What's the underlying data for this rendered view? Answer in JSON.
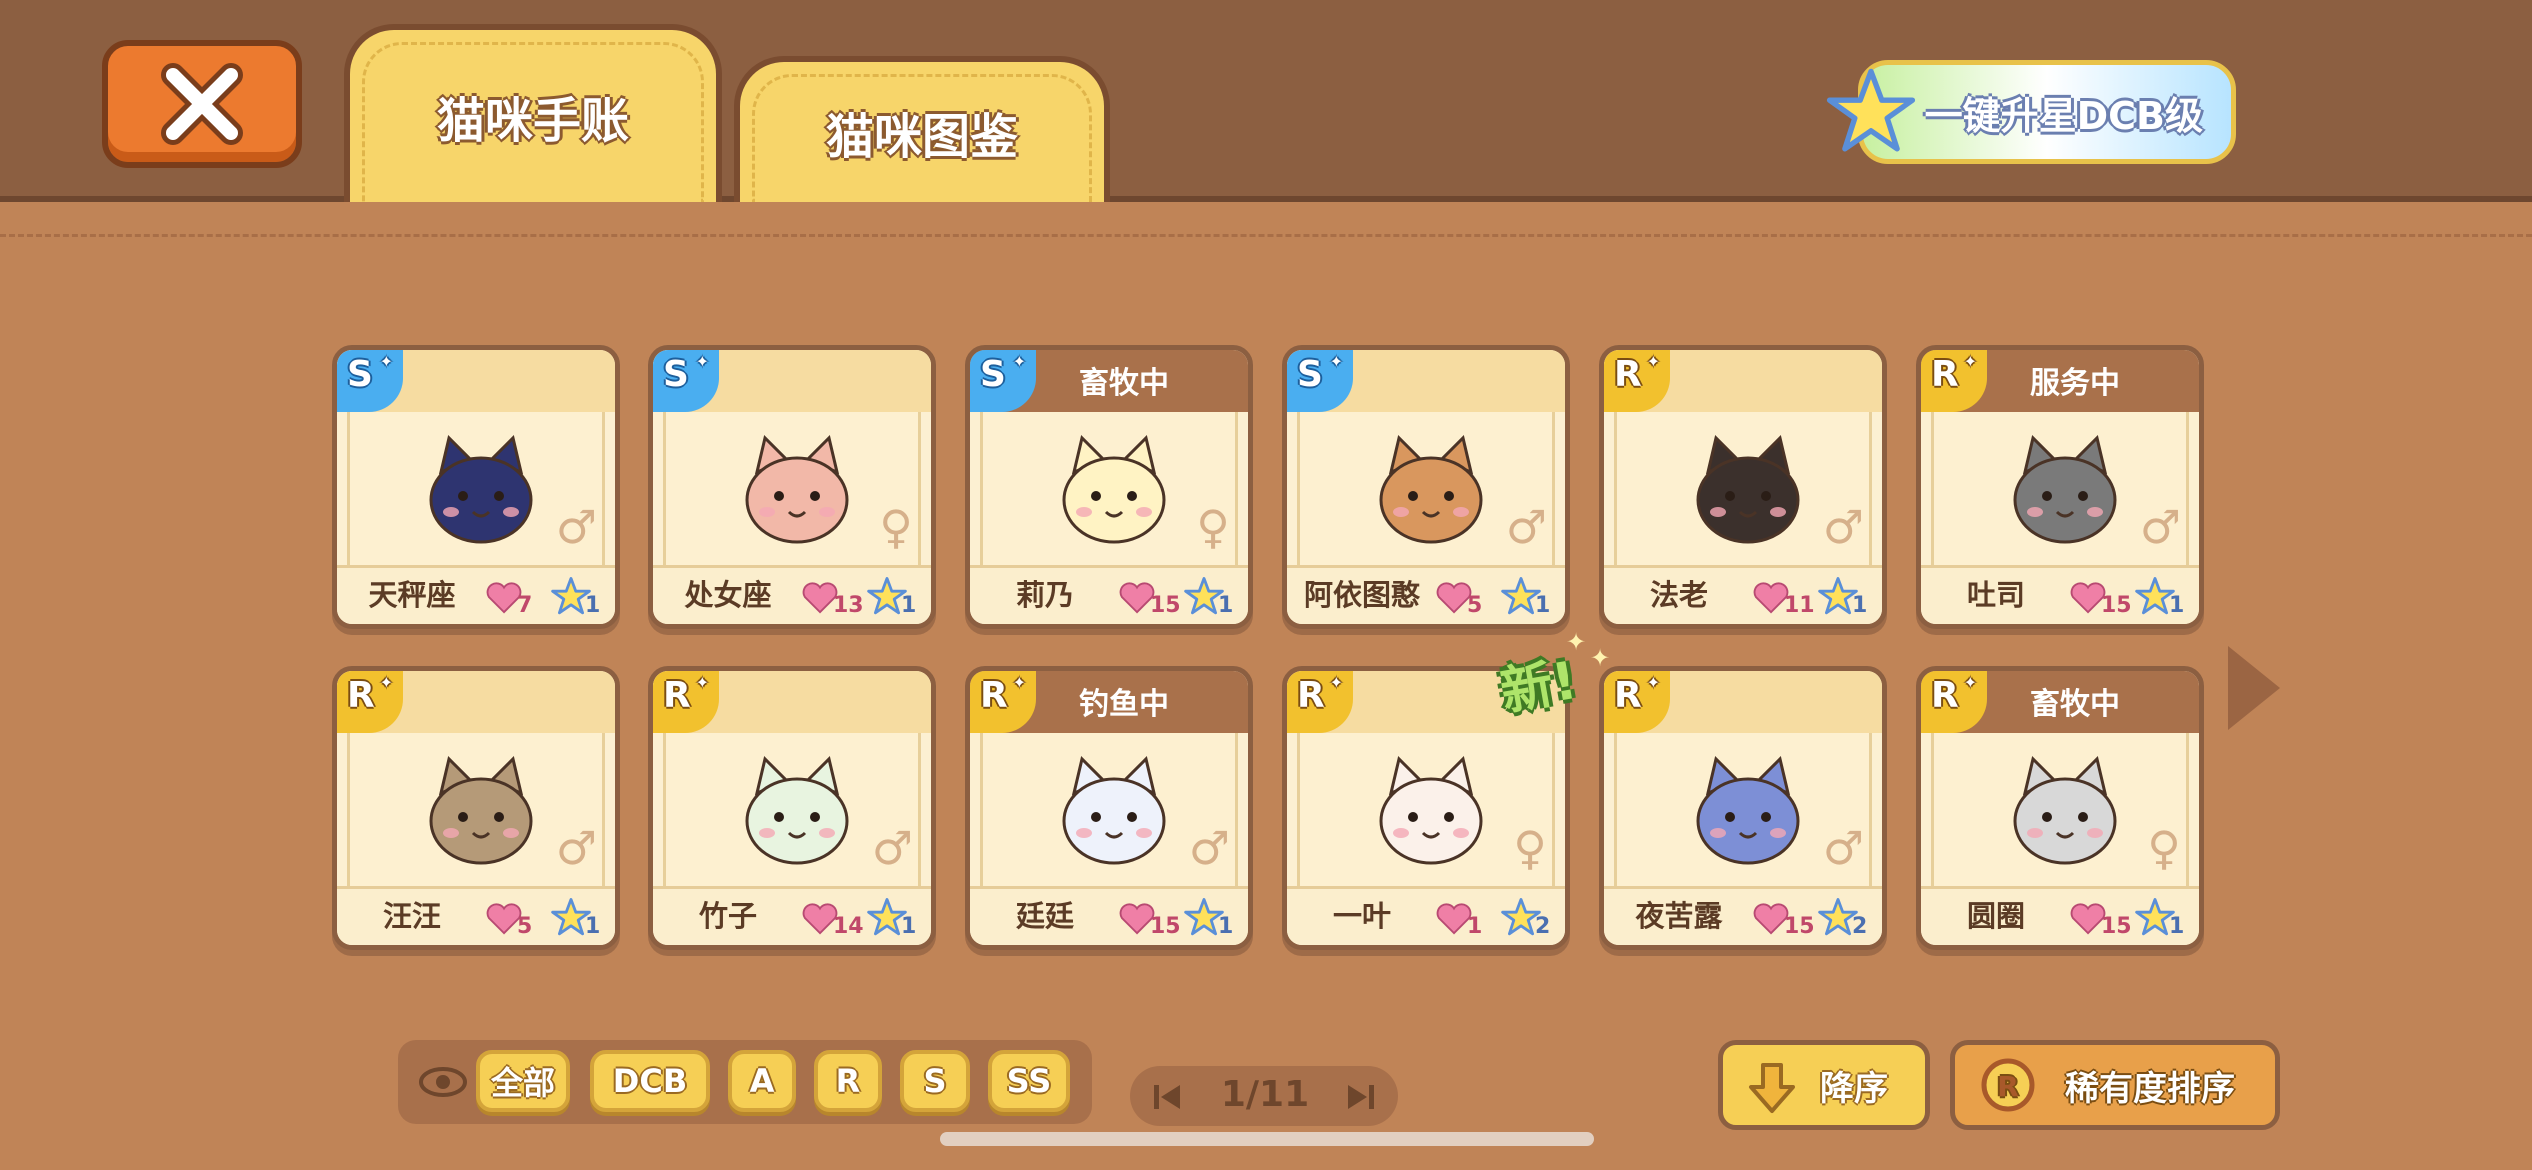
{
  "tabs": [
    {
      "label": "猫咪手账",
      "active": true
    },
    {
      "label": "猫咪图鉴",
      "active": false
    }
  ],
  "upgrade_label": "一键升星DCB级",
  "cats": [
    {
      "rarity": "S",
      "name": "天秤座",
      "love": "7",
      "stars": "1",
      "gender": "♂",
      "status": "",
      "color": "#2e3470"
    },
    {
      "rarity": "S",
      "name": "处女座",
      "love": "13",
      "stars": "1",
      "gender": "♀",
      "status": "",
      "color": "#f2b8a8"
    },
    {
      "rarity": "S",
      "name": "莉乃",
      "love": "15",
      "stars": "1",
      "gender": "♀",
      "status": "畜牧中",
      "color": "#fff3c4"
    },
    {
      "rarity": "S",
      "name": "阿依图憨",
      "love": "5",
      "stars": "1",
      "gender": "♂",
      "status": "",
      "color": "#d9975e"
    },
    {
      "rarity": "R",
      "name": "法老",
      "love": "11",
      "stars": "1",
      "gender": "♂",
      "status": "",
      "color": "#3b302c"
    },
    {
      "rarity": "R",
      "name": "吐司",
      "love": "15",
      "stars": "1",
      "gender": "♂",
      "status": "服务中",
      "color": "#7a7a7a"
    },
    {
      "rarity": "R",
      "name": "汪汪",
      "love": "5",
      "stars": "1",
      "gender": "♂",
      "status": "",
      "color": "#b59a78"
    },
    {
      "rarity": "R",
      "name": "竹子",
      "love": "14",
      "stars": "1",
      "gender": "♂",
      "status": "",
      "color": "#e8f4e0"
    },
    {
      "rarity": "R",
      "name": "廷廷",
      "love": "15",
      "stars": "1",
      "gender": "♂",
      "status": "钓鱼中",
      "color": "#eef2fb"
    },
    {
      "rarity": "R",
      "name": "一叶",
      "love": "1",
      "stars": "2",
      "gender": "♀",
      "status": "",
      "color": "#fbf1ea"
    },
    {
      "rarity": "R",
      "name": "夜苦露",
      "love": "15",
      "stars": "2",
      "gender": "♂",
      "status": "",
      "color": "#7d8fd6"
    },
    {
      "rarity": "R",
      "name": "圆圈",
      "love": "15",
      "stars": "1",
      "gender": "♀",
      "status": "畜牧中",
      "color": "#d8d8d8"
    }
  ],
  "new_label": "新!",
  "filters": [
    "全部",
    "DCB",
    "A",
    "R",
    "S",
    "SS"
  ],
  "pager": {
    "text": "1/11"
  },
  "sort": {
    "desc_label": "降序",
    "rarity_label": "稀有度排序"
  },
  "colors": {
    "bg": "#c08457",
    "topbar": "#8c5f41",
    "tab": "#f7d56a",
    "badge_s": "#4aaef0",
    "badge_r": "#f2c12e"
  }
}
